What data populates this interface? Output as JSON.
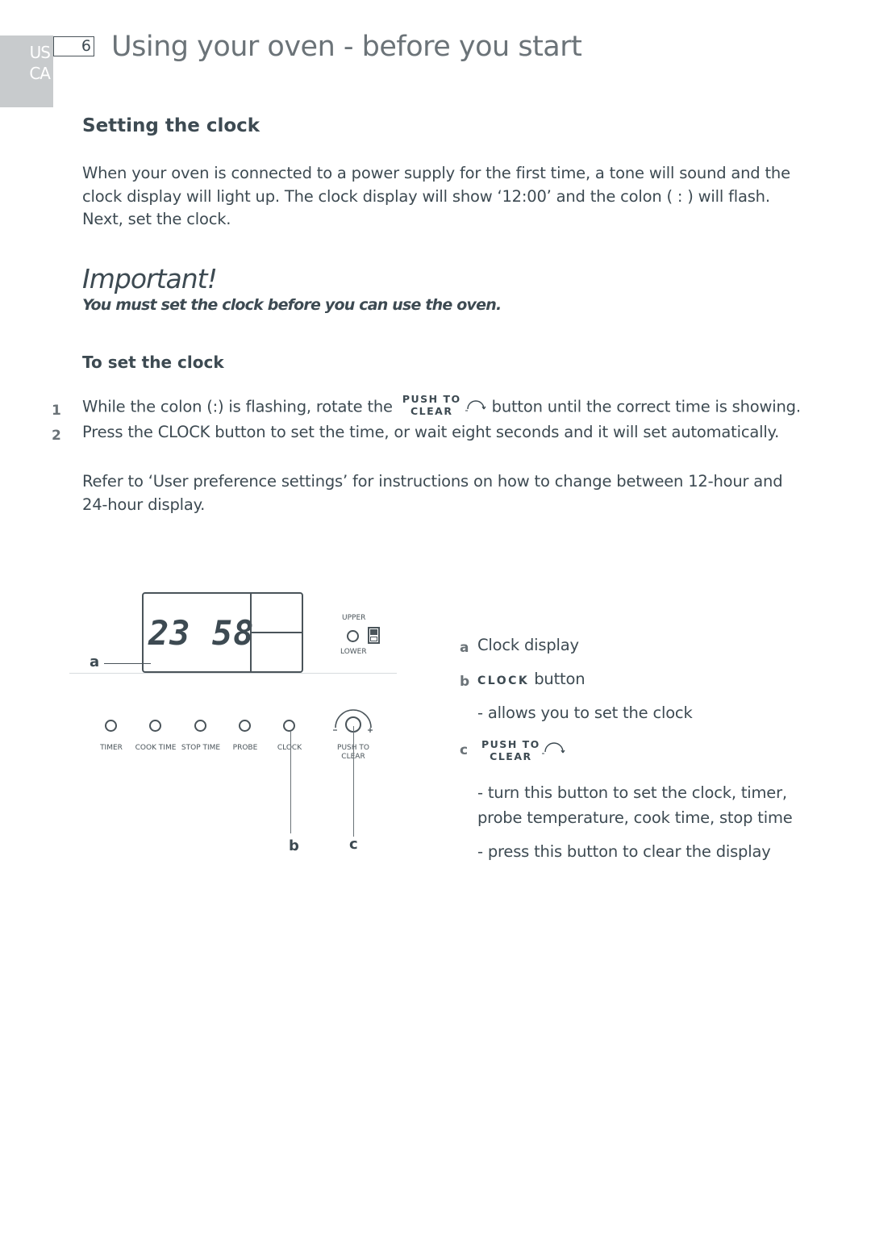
{
  "side_tab": {
    "region_1": "US",
    "region_2": "CA"
  },
  "page_number": "6",
  "page_title": "Using your oven - before you start",
  "section": {
    "heading": "Setting the clock",
    "intro": "When your oven is connected to a power supply for the first time, a tone will sound and the clock display will light up.  The clock display will show ‘12:00’ and the colon ( : ) will flash.  Next, set the clock."
  },
  "important": {
    "title": "Important!",
    "message": "You must set the clock before you can use the oven."
  },
  "procedure": {
    "heading": "To set the clock",
    "steps": [
      {
        "number": "1",
        "text_before": "While the colon (:) is flashing, rotate the",
        "button_line1": "PUSH TO",
        "button_line2": "CLEAR",
        "icon": "dial-arrow-icon",
        "text_after": "button until the correct time is showing."
      },
      {
        "number": "2",
        "text": "Press the CLOCK button to set the time, or wait eight seconds and it will set automatically."
      }
    ],
    "note": "Refer to ‘User preference settings’ for instructions on how to change between 12-hour and 24-hour display."
  },
  "diagram": {
    "display_digits": "23 58",
    "upper_label": "UPPER",
    "lower_label": "LOWER",
    "buttons": [
      {
        "label": "TIMER"
      },
      {
        "label": "COOK TIME"
      },
      {
        "label": "STOP TIME"
      },
      {
        "label": "PROBE"
      },
      {
        "label": "CLOCK"
      }
    ],
    "knob": {
      "minus": "−",
      "plus": "+",
      "label_line1": "PUSH TO",
      "label_line2": "CLEAR"
    },
    "callouts": {
      "a": "a",
      "b": "b",
      "c": "c"
    }
  },
  "legend": {
    "a": {
      "letter": "a",
      "text": "Clock display"
    },
    "b": {
      "letter": "b",
      "caps": "CLOCK",
      "text": "button",
      "desc": "- allows you to set the clock"
    },
    "c": {
      "letter": "c",
      "line1": "PUSH TO",
      "line2": "CLEAR",
      "desc1": "- turn this button to set the clock, timer,",
      "desc2": "probe temperature, cook time, stop time",
      "desc3": "- press this button to clear the display"
    }
  },
  "colors": {
    "text": "#3d4a52",
    "title": "#6b7378",
    "tab": "#c8cbcd"
  }
}
